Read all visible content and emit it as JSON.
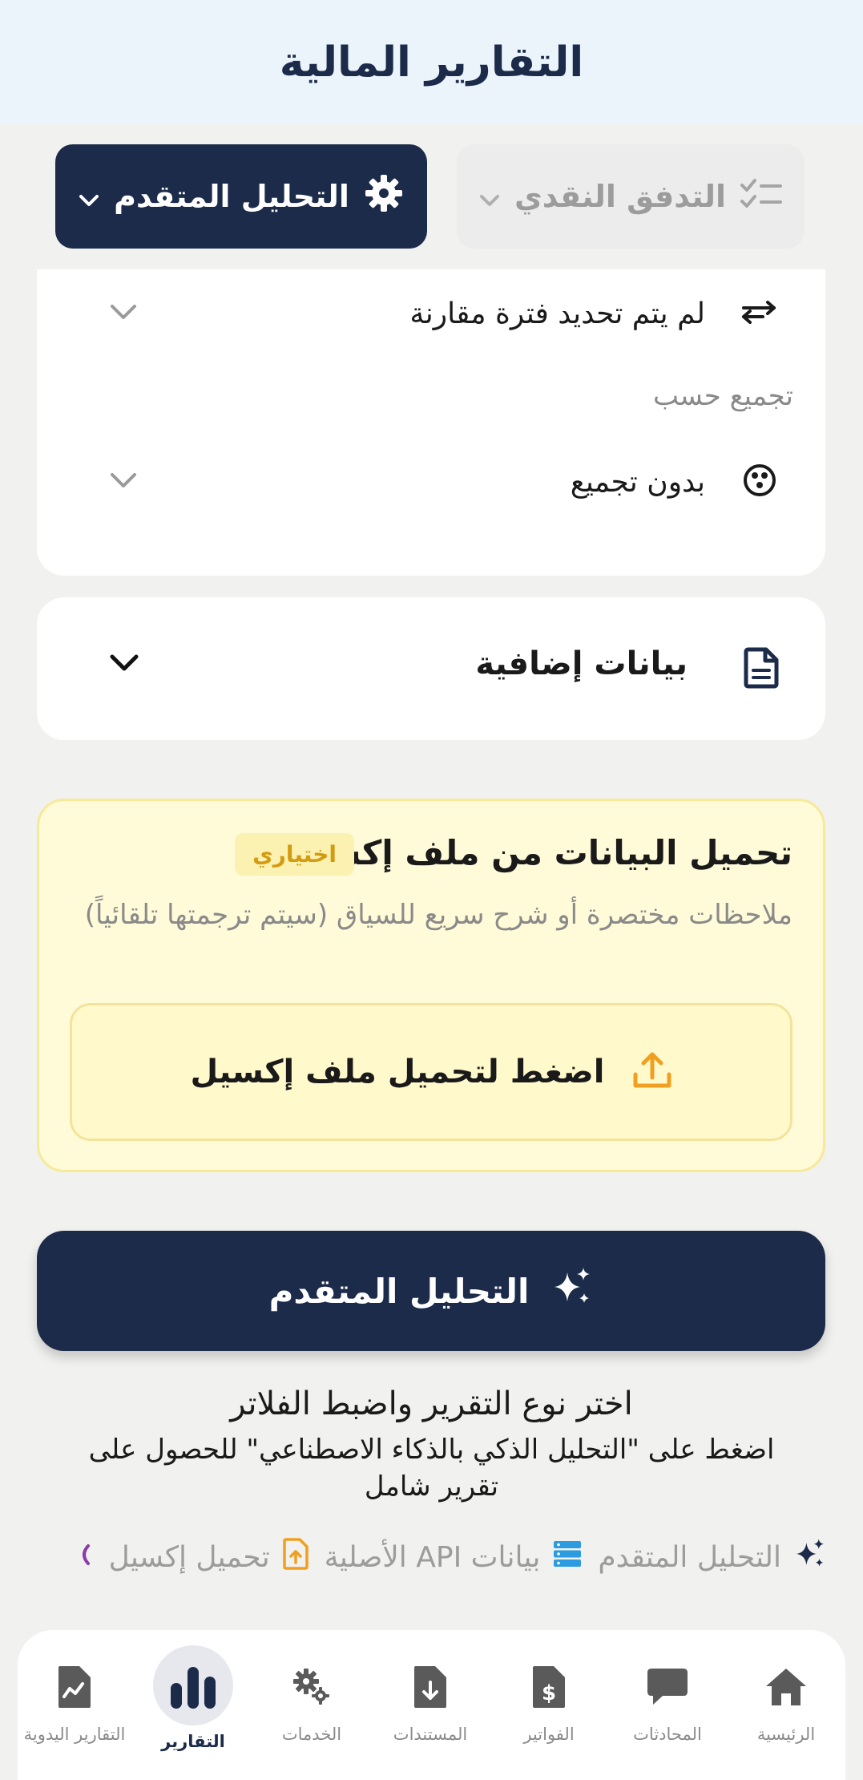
{
  "header": {
    "title": "التقارير المالية"
  },
  "selectors": {
    "report_type": {
      "label": "التدفق النقدي",
      "icon": "checklist-icon"
    },
    "analysis": {
      "label": "التحليل المتقدم",
      "icon": "gear-icon"
    }
  },
  "filters": {
    "comparison": {
      "value": "لم يتم تحديد فترة مقارنة",
      "icon": "compare-arrows-icon"
    },
    "group_by": {
      "label": "تجميع حسب",
      "value": "بدون تجميع",
      "icon": "dots-circle-icon"
    }
  },
  "extra": {
    "label": "بيانات إضافية",
    "icon": "document-icon"
  },
  "upload": {
    "title": "تحميل البيانات من ملف إكسيل",
    "badge": "اختياري",
    "description": "ملاحظات مختصرة أو شرح سريع للسياق (سيتم ترجمتها تلقائياً)",
    "button_label": "اضغط لتحميل ملف إكسيل"
  },
  "analyze_button": {
    "label": "التحليل المتقدم"
  },
  "hint": {
    "title": "اختر نوع التقرير واضبط الفلاتر",
    "body": "اضغط على \"التحليل الذكي بالذكاء الاصطناعي\" للحصول على تقرير شامل"
  },
  "features": [
    {
      "label": "التحليل المتقدم",
      "icon": "sparkles-icon",
      "color": "#1c2b4a"
    },
    {
      "label": "بيانات API الأصلية",
      "icon": "server-icon",
      "color": "#2d9be0"
    },
    {
      "label": "تحميل إكسيل",
      "icon": "file-upload-icon",
      "color": "#f0a020"
    }
  ],
  "nav": [
    {
      "label": "الرئيسية",
      "icon": "home-icon"
    },
    {
      "label": "المحادثات",
      "icon": "chat-icon"
    },
    {
      "label": "الفواتير",
      "icon": "invoice-icon"
    },
    {
      "label": "المستندات",
      "icon": "file-download-icon"
    },
    {
      "label": "الخدمات",
      "icon": "gears-icon"
    },
    {
      "label": "التقارير",
      "icon": "bar-chart-icon",
      "active": true
    },
    {
      "label": "التقارير اليدوية",
      "icon": "file-chart-icon"
    }
  ],
  "colors": {
    "primary": "#1c2b4a",
    "accent": "#f0a020",
    "muted": "#9c9c9c"
  }
}
